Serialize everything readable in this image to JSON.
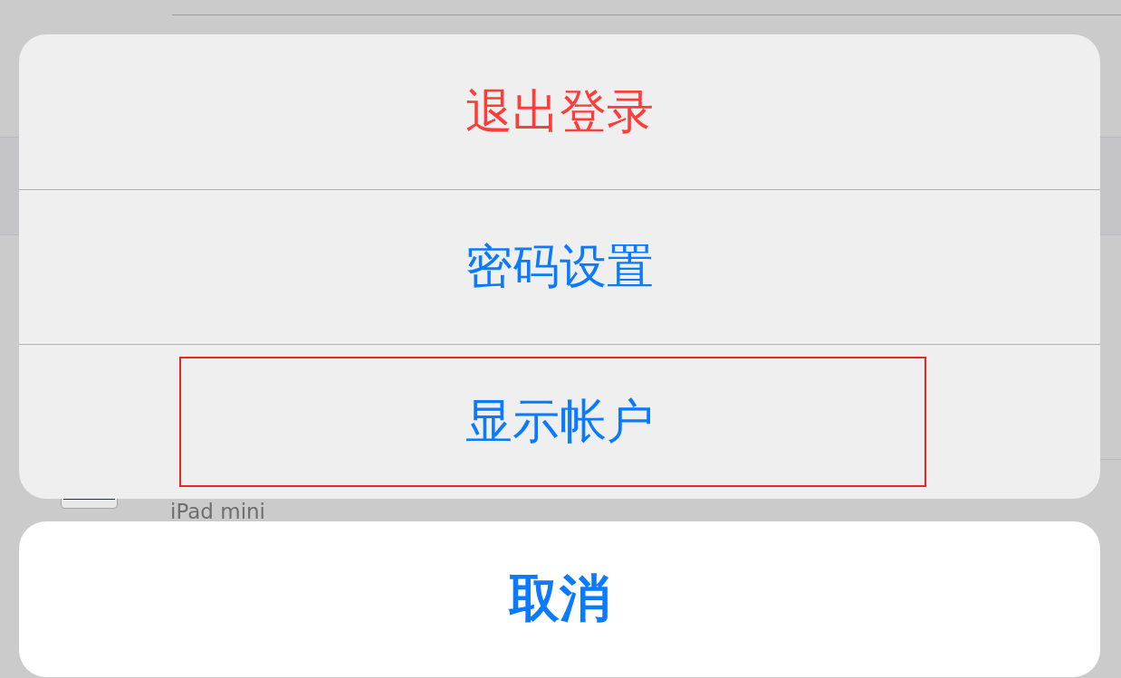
{
  "background": {
    "device_name": "iPad mini"
  },
  "actions": [
    {
      "label": "退出登录",
      "kind": "destructive",
      "highlighted": false
    },
    {
      "label": "密码设置",
      "kind": "default",
      "highlighted": false
    },
    {
      "label": "显示帐户",
      "kind": "default",
      "highlighted": true
    }
  ],
  "cancel": {
    "label": "取消"
  }
}
